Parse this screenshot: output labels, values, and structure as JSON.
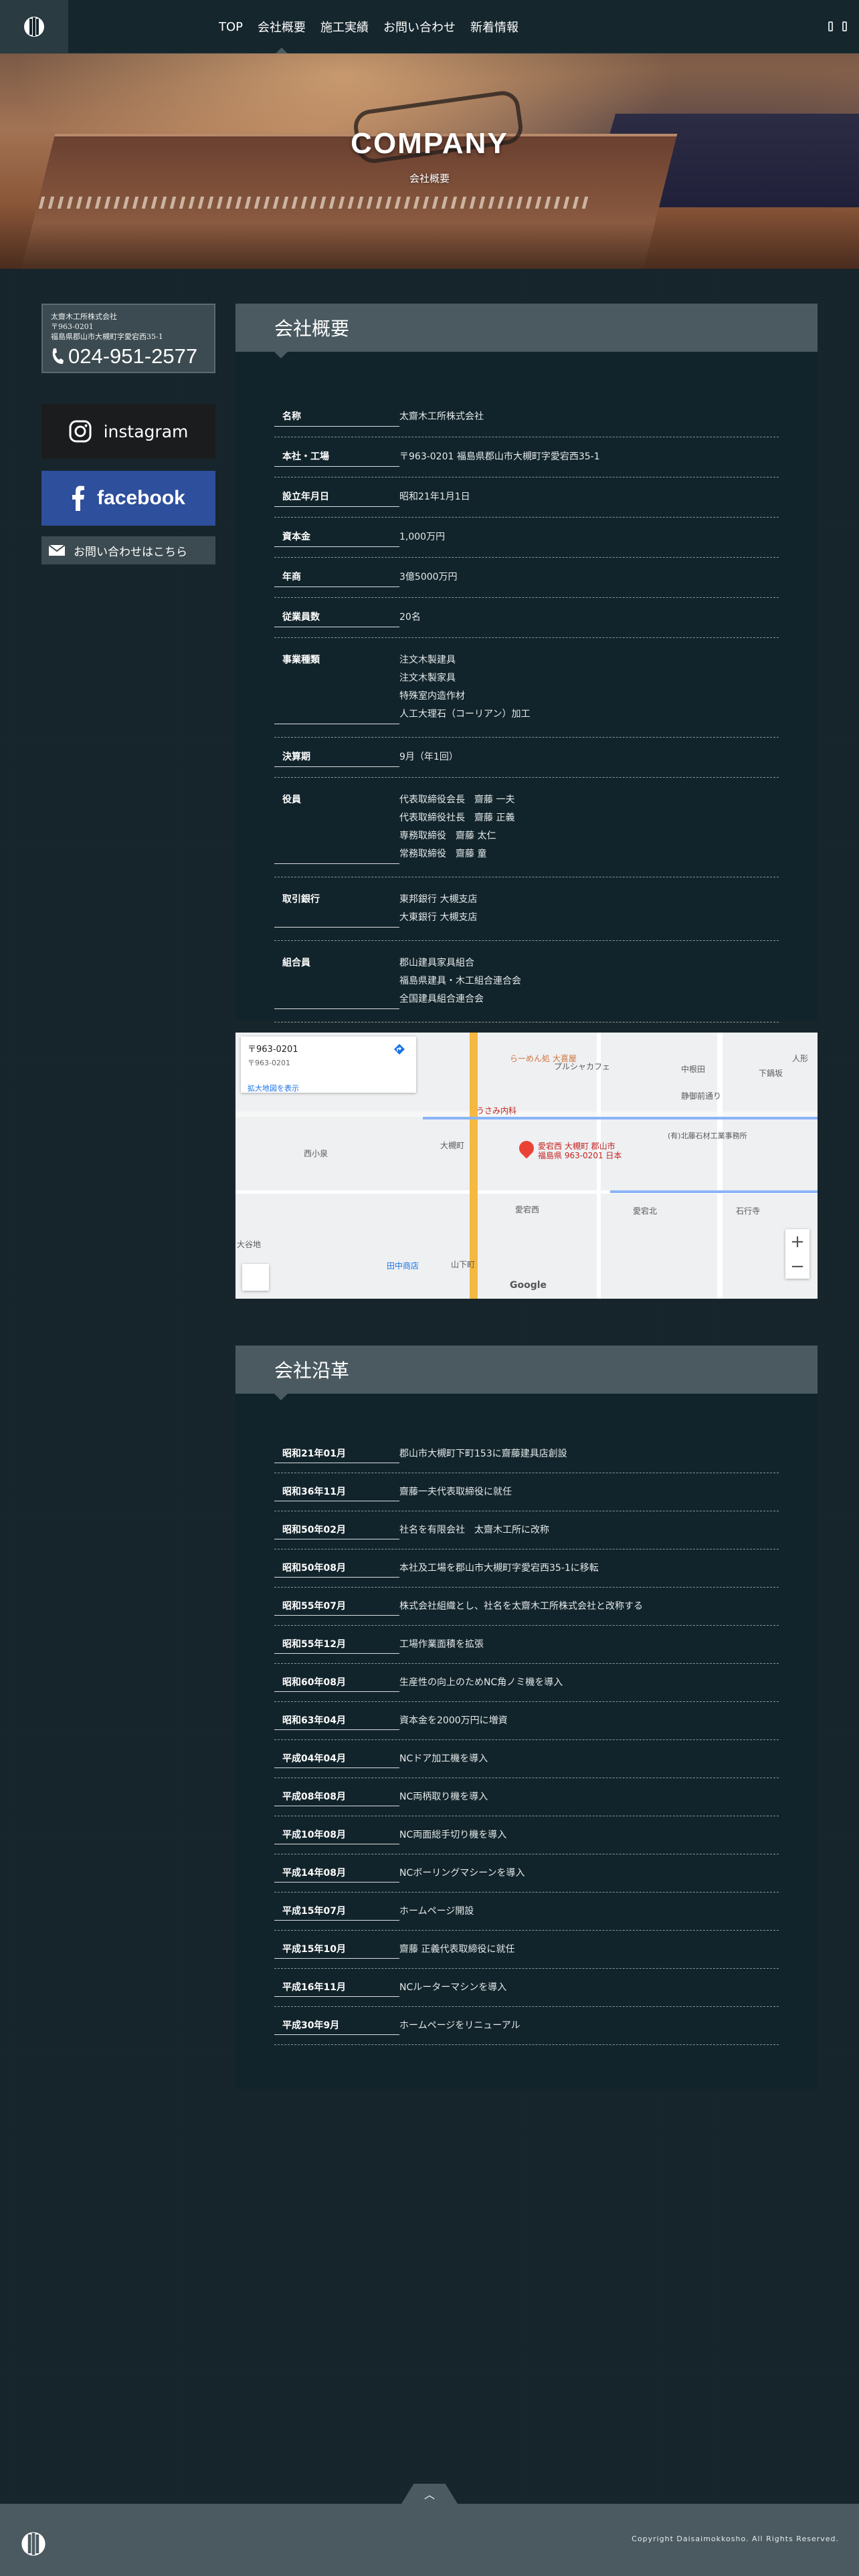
{
  "header": {
    "logo": "logo-icon",
    "nav": [
      "TOP",
      "会社概要",
      "施工実績",
      "お問い合わせ",
      "新着情報"
    ],
    "active_nav": "会社概要",
    "icons": [
      "menu-icon",
      "menu-icon"
    ]
  },
  "hero": {
    "title": "COMPANY",
    "subtitle": "会社概要"
  },
  "sidebar": {
    "info": {
      "company": "太齋木工所株式会社",
      "zip": "〒963-0201",
      "address": "福島県郡山市大槻町字愛宕西35-1",
      "tel": "024-951-2577"
    },
    "instagram": "instagram",
    "facebook": "facebook",
    "contact": "お問い合わせはこちら"
  },
  "overview": {
    "title": "会社概要",
    "rows": [
      {
        "key": "名称",
        "lines": [
          "太齋木工所株式会社"
        ]
      },
      {
        "key": "本社・工場",
        "lines": [
          "〒963-0201 福島県郡山市大槻町字愛宕西35-1"
        ]
      },
      {
        "key": "設立年月日",
        "lines": [
          "昭和21年1月1日"
        ]
      },
      {
        "key": "資本金",
        "lines": [
          "1,000万円"
        ]
      },
      {
        "key": "年商",
        "lines": [
          "3億5000万円"
        ]
      },
      {
        "key": "従業員数",
        "lines": [
          "20名"
        ]
      },
      {
        "key": "事業種類",
        "lines": [
          "注文木製建具",
          "注文木製家具",
          "特殊室内造作材",
          "人工大理石（コーリアン）加工"
        ]
      },
      {
        "key": "決算期",
        "lines": [
          "9月（年1回）"
        ]
      },
      {
        "key": "役員",
        "lines": [
          "代表取締役会長　齋藤 一夫",
          "代表取締役社長　齋藤 正義",
          "専務取締役　齋藤 太仁",
          "常務取締役　齋藤 童"
        ]
      },
      {
        "key": "取引銀行",
        "lines": [
          "東邦銀行 大槻支店",
          "大東銀行 大槻支店"
        ]
      },
      {
        "key": "組合員",
        "lines": [
          "郡山建具家具組合",
          "福島県建具・木工組合連合会",
          "全国建具組合連合会"
        ]
      }
    ]
  },
  "map": {
    "card_title": "〒963-0201",
    "card_sub": "〒963-0201",
    "card_link": "拡大地図を表示",
    "pin_label_1": "愛宕西 大槻町 郡山市",
    "pin_label_2": "福島県 963-0201 日本",
    "labels": [
      "らーめん処 大喜屋",
      "うさみ内科",
      "大槻町",
      "愛宕西",
      "愛宕北",
      "石行寺",
      "西小泉",
      "大谷地",
      "山下町",
      "田中商店",
      "(有)北藤石材工業事務所",
      "静御前通り",
      "プルシャカフェ",
      "中根田",
      "下鍋坂",
      "人形",
      "Google"
    ],
    "zoom_in": "+",
    "zoom_out": "−"
  },
  "history": {
    "title": "会社沿革",
    "rows": [
      {
        "key": "昭和21年01月",
        "value": "郡山市大槻町下町153に齋藤建具店創設"
      },
      {
        "key": "昭和36年11月",
        "value": "齋藤一夫代表取締役に就任"
      },
      {
        "key": "昭和50年02月",
        "value": "社名を有限会社　太齋木工所に改称"
      },
      {
        "key": "昭和50年08月",
        "value": "本社及工場を郡山市大槻町字愛宕西35-1に移転"
      },
      {
        "key": "昭和55年07月",
        "value": "株式会社組織とし、社名を太齋木工所株式会社と改称する"
      },
      {
        "key": "昭和55年12月",
        "value": "工場作業面積を拡張"
      },
      {
        "key": "昭和60年08月",
        "value": "生産性の向上のためNC角ノミ機を導入"
      },
      {
        "key": "昭和63年04月",
        "value": "資本金を2000万円に増資"
      },
      {
        "key": "平成04年04月",
        "value": "NCドア加工機を導入"
      },
      {
        "key": "平成08年08月",
        "value": "NC両柄取り機を導入"
      },
      {
        "key": "平成10年08月",
        "value": "NC両面総手切り機を導入"
      },
      {
        "key": "平成14年08月",
        "value": "NCボーリングマシーンを導入"
      },
      {
        "key": "平成15年07月",
        "value": "ホームページ開設"
      },
      {
        "key": "平成15年10月",
        "value": "齋藤 正義代表取締役に就任"
      },
      {
        "key": "平成16年11月",
        "value": "NCルーターマシンを導入"
      },
      {
        "key": "平成30年9月",
        "value": "ホームページをリニューアル"
      }
    ]
  },
  "footer": {
    "pagetop": "︿",
    "copyright": "Copyright Daisaimokkosho. All Rights Reserved."
  }
}
